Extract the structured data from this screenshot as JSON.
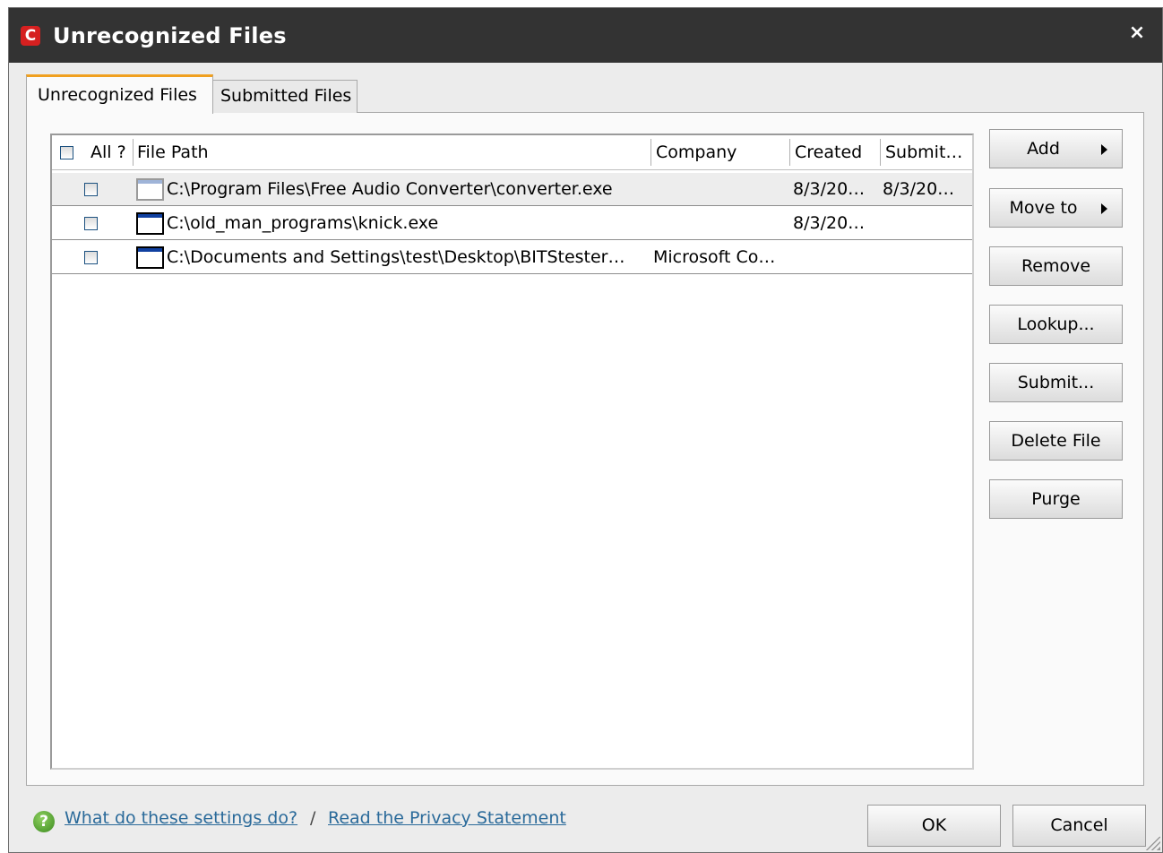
{
  "window": {
    "title": "Unrecognized Files",
    "logo_letter": "C",
    "close_glyph": "×"
  },
  "tabs": [
    {
      "label": "Unrecognized Files",
      "active": true
    },
    {
      "label": "Submitted Files",
      "active": false
    }
  ],
  "table": {
    "headers": {
      "select_all": "All ?",
      "file_path": "File Path",
      "company": "Company",
      "created": "Created",
      "submitted": "Submit…"
    },
    "rows": [
      {
        "path": "C:\\Program Files\\Free Audio Converter\\converter.exe",
        "company": "",
        "created": "8/3/20…",
        "submitted": "8/3/20…",
        "selected": true
      },
      {
        "path": "C:\\old_man_programs\\knick.exe",
        "company": "",
        "created": "8/3/20…",
        "submitted": "",
        "selected": false
      },
      {
        "path": "C:\\Documents and Settings\\test\\Desktop\\BITStester…",
        "company": "Microsoft Co…",
        "created": "",
        "submitted": "",
        "selected": false
      }
    ]
  },
  "buttons": {
    "add": "Add",
    "move_to": "Move to",
    "remove": "Remove",
    "lookup": "Lookup...",
    "submit": "Submit...",
    "delete_file": "Delete File",
    "purge": "Purge"
  },
  "footer": {
    "help_link": "What do these settings do?",
    "separator": "/",
    "privacy_link": "Read the Privacy Statement",
    "ok": "OK",
    "cancel": "Cancel"
  },
  "colors": {
    "titlebar": "#333333",
    "logo": "#d62020",
    "active_tab_accent": "#f0a020",
    "link": "#2a6a9a"
  }
}
